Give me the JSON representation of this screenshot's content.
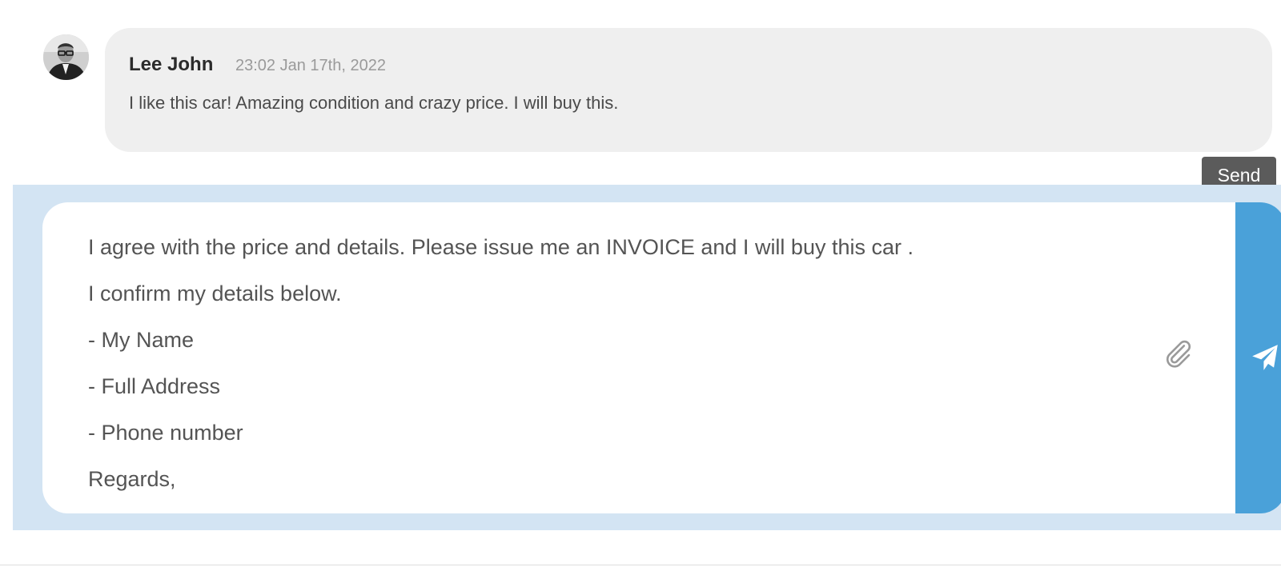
{
  "comment": {
    "author": "Lee John",
    "timestamp": "23:02 Jan 17th, 2022",
    "text": "I like this car! Amazing condition and crazy price. I will buy this."
  },
  "composer": {
    "lines": [
      "I agree with the price and details. Please issue me an INVOICE and I will buy this car .",
      "I confirm my details below.",
      "- My Name",
      "- Full Address",
      "- Phone number",
      "Regards,"
    ],
    "attach_icon": "paperclip-icon",
    "send_icon": "paper-plane-icon",
    "send_tooltip": "Send"
  },
  "colors": {
    "composer_background": "#d3e4f3",
    "send_button": "#4aa1d9",
    "comment_bubble": "#efefef",
    "tooltip": "#5b5b5b"
  }
}
